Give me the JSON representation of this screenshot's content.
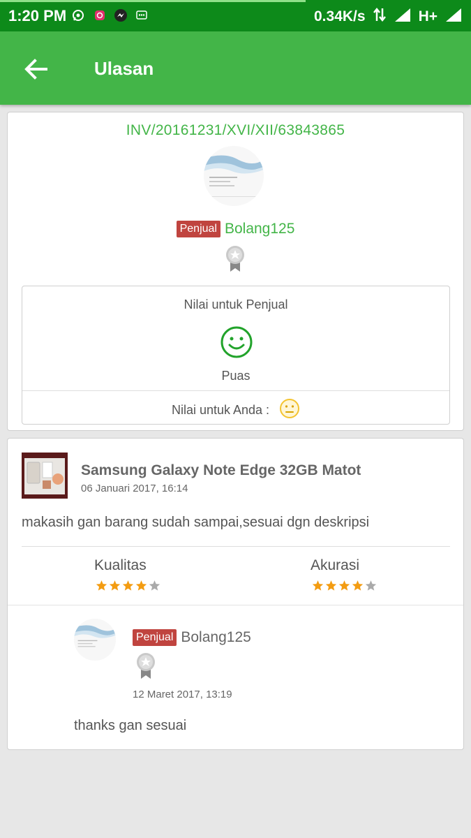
{
  "status_bar": {
    "time": "1:20 PM",
    "speed": "0.34K/s",
    "network": "H+",
    "notifications": [
      "whatsapp-icon",
      "instagram-icon",
      "messenger-icon",
      "bbm-icon"
    ]
  },
  "app_bar": {
    "title": "Ulasan"
  },
  "transaction": {
    "invoice": "INV/20161231/XVI/XII/63843865",
    "seller_badge": "Penjual",
    "seller_name": "Bolang125",
    "rating_box": {
      "title": "Nilai untuk Penjual",
      "seller_rating": "Puas",
      "you_label": "Nilai untuk Anda :"
    }
  },
  "review": {
    "product_name": "Samsung Galaxy Note Edge 32GB Matot",
    "date": "06 Januari 2017, 16:14",
    "text": "makasih gan barang sudah sampai,sesuai dgn deskripsi",
    "quality_label": "Kualitas",
    "quality_stars": 4,
    "accuracy_label": "Akurasi",
    "accuracy_stars": 4,
    "max_stars": 5
  },
  "reply": {
    "seller_badge": "Penjual",
    "seller_name": "Bolang125",
    "date": "12 Maret 2017, 13:19",
    "text": "thanks gan sesuai"
  },
  "colors": {
    "status_bar": "#0d8a1a",
    "app_bar": "#43b548",
    "accent_green": "#43b548",
    "badge_red": "#c0443f",
    "star_filled": "#f39c12",
    "star_empty": "#aaaaaa",
    "neutral_face": "#f4c430"
  }
}
